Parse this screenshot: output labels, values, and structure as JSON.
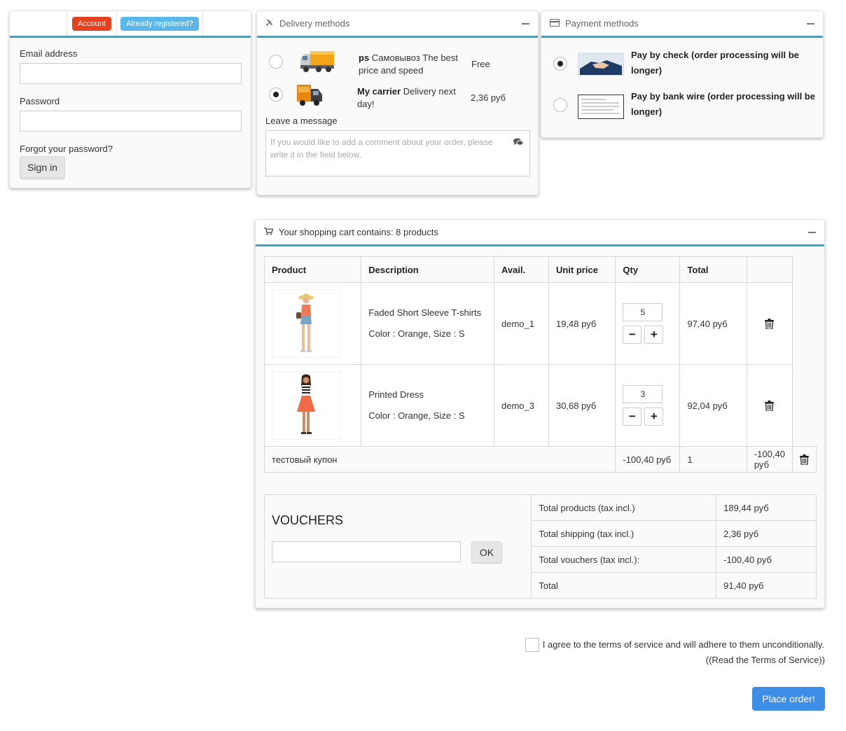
{
  "login": {
    "tab_account": "Account",
    "tab_registered": "Already registered?",
    "email_label": "Email address",
    "email_value": "",
    "password_label": "Password",
    "password_value": "",
    "forgot_label": "Forgot your password?",
    "sign_in_label": "Sign in"
  },
  "delivery": {
    "title": "Delivery methods",
    "carriers": [
      {
        "name": "ps",
        "desc": "Самовывоз The best price and speed",
        "price": "Free",
        "selected": false
      },
      {
        "name": "My carrier",
        "desc": "Delivery next day!",
        "price": "2,36 руб",
        "selected": true
      }
    ],
    "message_label": "Leave a message",
    "message_placeholder": "If you would like to add a comment about your order, please write it in the field below."
  },
  "payment": {
    "title": "Payment methods",
    "methods": [
      {
        "label": "Pay by check (order processing will be longer)",
        "selected": true
      },
      {
        "label": "Pay by bank wire (order processing will be longer)",
        "selected": false
      }
    ]
  },
  "cart": {
    "title": "Your shopping cart contains: 8 products",
    "headers": {
      "product": "Product",
      "description": "Description",
      "avail": "Avail.",
      "unit_price": "Unit price",
      "qty": "Qty",
      "total": "Total"
    },
    "items": [
      {
        "name": "Faded Short Sleeve T-shirts",
        "attrs": "Color : Orange, Size : S",
        "ref": "demo_1",
        "unit_price": "19,48 руб",
        "qty": "5",
        "total": "97,40 руб"
      },
      {
        "name": "Printed Dress",
        "attrs": "Color : Orange, Size : S",
        "ref": "demo_3",
        "unit_price": "30,68 руб",
        "qty": "3",
        "total": "92,04 руб"
      }
    ],
    "discount": {
      "name": "тестовый купон",
      "unit_price": "-100,40 руб",
      "qty": "1",
      "total": "-100,40 руб"
    },
    "vouchers_title": "VOUCHERS",
    "voucher_value": "",
    "ok_label": "OK",
    "totals": [
      {
        "label": "Total products (tax incl.)",
        "value": "189,44 руб"
      },
      {
        "label": "Total shipping (tax incl.)",
        "value": "2,36 руб"
      },
      {
        "label": "Total vouchers (tax incl.):",
        "value": "-100,40 руб"
      },
      {
        "label": "Total",
        "value": "91,40 руб"
      }
    ]
  },
  "terms": {
    "agree_label": "I agree to the terms of service and will adhere to them unconditionally.",
    "read_link": "((Read the Terms of Service))"
  },
  "place_order_label": "Place order!"
}
